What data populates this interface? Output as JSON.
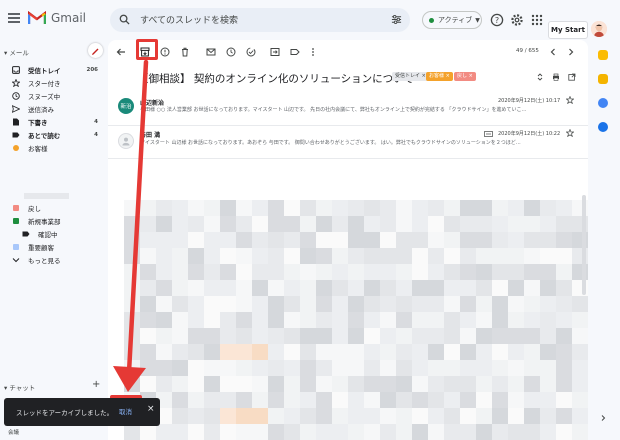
{
  "header": {
    "logo_text": "Gmail",
    "search_placeholder": "すべてのスレッドを検索",
    "status_label": "アクティブ",
    "mystart_label": "My Start"
  },
  "sidebar": {
    "mail_section": "メール",
    "chat_section": "チャット",
    "items": [
      {
        "label": "受信トレイ",
        "count": "206",
        "bold": true
      },
      {
        "label": "スター付き",
        "count": ""
      },
      {
        "label": "スヌーズ中",
        "count": ""
      },
      {
        "label": "送信済み",
        "count": ""
      },
      {
        "label": "下書き",
        "count": "4",
        "bold": true
      },
      {
        "label": "あとで読む",
        "count": "4",
        "bold": true
      },
      {
        "label": "お客様",
        "count": ""
      }
    ],
    "lower_items": [
      {
        "label": "戻し"
      },
      {
        "label": "新規事業部"
      },
      {
        "label": "確認中"
      },
      {
        "label": "重要顧客"
      },
      {
        "label": "もっと見る"
      }
    ],
    "bottom_label": "会議"
  },
  "toolbar": {
    "pager": "49 / 655"
  },
  "thread": {
    "subject": "【御相談】 契約のオンライン化のソリューションについて",
    "chips": [
      "受信トレイ ×",
      "お客様 ×",
      "戻し ×"
    ],
    "messages": [
      {
        "avatar_text": "新治",
        "sender": "山辺新治",
        "date": "2020年9月12日(土) 10:17",
        "snippet": "与田様 ○○ 法人営業部 お世話になっております。マイスタート 山辺です。 先日の社内会議にて、弊社もオンライン上で契約が完結する 「クラウドサイン」を進めていこ…"
      },
      {
        "avatar_text": "",
        "sender": "与田 満",
        "date": "2020年9月12日(土) 10:22",
        "snippet": "マイスタート 山辺様 お世話になっております。あおぞら 与田です。 御問い合わせありがとうございます。 はい。弊社でもクラウドサインのソリューションを２つほど…"
      }
    ]
  },
  "snackbar": {
    "message": "スレッドをアーカイブしました。",
    "undo": "取消",
    "close": "×"
  },
  "colors": {
    "accent_red": "#e53935",
    "avatar_teal": "#1a8a7a"
  }
}
